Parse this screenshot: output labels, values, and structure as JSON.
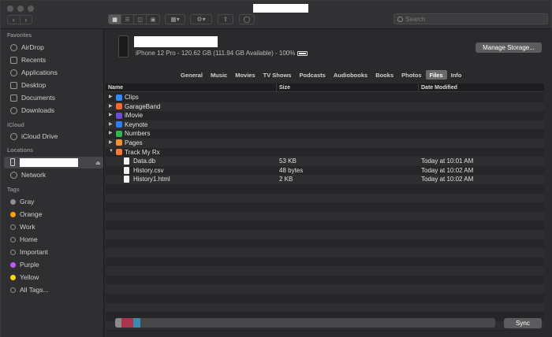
{
  "toolbar": {
    "search_placeholder": "Search"
  },
  "sidebar": {
    "favorites_title": "Favorites",
    "favorites": [
      {
        "label": "AirDrop",
        "icon": "airdrop-icon"
      },
      {
        "label": "Recents",
        "icon": "clock-icon"
      },
      {
        "label": "Applications",
        "icon": "applications-icon"
      },
      {
        "label": "Desktop",
        "icon": "desktop-icon"
      },
      {
        "label": "Documents",
        "icon": "document-icon"
      },
      {
        "label": "Downloads",
        "icon": "download-icon"
      }
    ],
    "icloud_title": "iCloud",
    "icloud": [
      {
        "label": "iCloud Drive",
        "icon": "cloud-icon"
      }
    ],
    "locations_title": "Locations",
    "network_label": "Network",
    "tags_title": "Tags",
    "tags": [
      {
        "label": "Gray",
        "color": "#8e8e93"
      },
      {
        "label": "Orange",
        "color": "#ff9f0a"
      },
      {
        "label": "Work",
        "color": ""
      },
      {
        "label": "Home",
        "color": ""
      },
      {
        "label": "Important",
        "color": ""
      },
      {
        "label": "Purple",
        "color": "#bf5af2"
      },
      {
        "label": "Yellow",
        "color": "#ffd60a"
      },
      {
        "label": "All Tags...",
        "color": ""
      }
    ]
  },
  "device": {
    "info": "iPhone 12 Pro - 120.62 GB (111.94 GB Available) - 100%",
    "manage_storage_label": "Manage Storage..."
  },
  "tabs": [
    {
      "label": "General",
      "active": false
    },
    {
      "label": "Music",
      "active": false
    },
    {
      "label": "Movies",
      "active": false
    },
    {
      "label": "TV Shows",
      "active": false
    },
    {
      "label": "Podcasts",
      "active": false
    },
    {
      "label": "Audiobooks",
      "active": false
    },
    {
      "label": "Books",
      "active": false
    },
    {
      "label": "Photos",
      "active": false
    },
    {
      "label": "Files",
      "active": true
    },
    {
      "label": "Info",
      "active": false
    }
  ],
  "table": {
    "columns": [
      "Name",
      "Size",
      "Date Modified"
    ],
    "rows": [
      {
        "name": "Clips",
        "size": "",
        "date": "",
        "kind": "app",
        "color": "#2f8cf5",
        "expanded": false
      },
      {
        "name": "GarageBand",
        "size": "",
        "date": "",
        "kind": "app",
        "color": "#f56a2f",
        "expanded": false
      },
      {
        "name": "iMovie",
        "size": "",
        "date": "",
        "kind": "app",
        "color": "#6b4bd8",
        "expanded": false
      },
      {
        "name": "Keynote",
        "size": "",
        "date": "",
        "kind": "app",
        "color": "#2f7cf5",
        "expanded": false
      },
      {
        "name": "Numbers",
        "size": "",
        "date": "",
        "kind": "app",
        "color": "#2fb84a",
        "expanded": false
      },
      {
        "name": "Pages",
        "size": "",
        "date": "",
        "kind": "app",
        "color": "#f5902f",
        "expanded": false
      },
      {
        "name": "Track My Rx",
        "size": "",
        "date": "",
        "kind": "app",
        "color": "#f57a2f",
        "expanded": true
      },
      {
        "name": "Data.db",
        "size": "53 KB",
        "date": "Today at 10:01 AM",
        "kind": "file",
        "color": "",
        "expanded": false
      },
      {
        "name": "History.csv",
        "size": "48 bytes",
        "date": "Today at 10:02 AM",
        "kind": "file",
        "color": "",
        "expanded": false
      },
      {
        "name": "History1.html",
        "size": "2 KB",
        "date": "Today at 10:02 AM",
        "kind": "file",
        "color": "",
        "expanded": false
      }
    ]
  },
  "storage": {
    "segments": [
      {
        "color": "#8a8a8c",
        "fraction": 0.017
      },
      {
        "color": "#a8344e",
        "fraction": 0.03
      },
      {
        "color": "#3b8ab0",
        "fraction": 0.02
      }
    ]
  },
  "sync_label": "Sync"
}
